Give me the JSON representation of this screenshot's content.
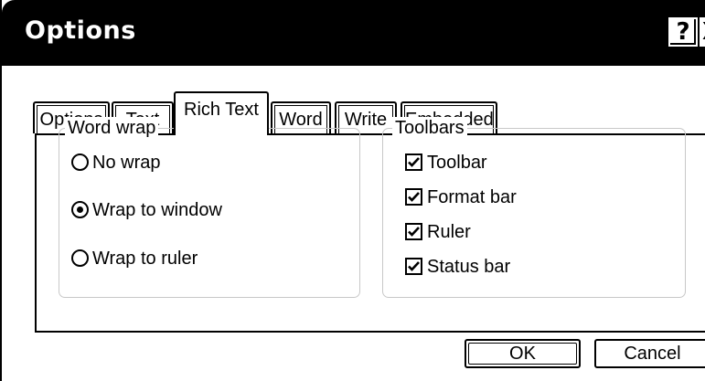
{
  "window": {
    "title": "Options",
    "help_glyph": "?",
    "close_glyph": "X"
  },
  "tabs": [
    {
      "label": "Options",
      "active": false
    },
    {
      "label": "Text",
      "active": false
    },
    {
      "label": "Rich Text",
      "active": true
    },
    {
      "label": "Word",
      "active": false
    },
    {
      "label": "Write",
      "active": false
    },
    {
      "label": "Embedded",
      "active": false
    }
  ],
  "word_wrap": {
    "label": "Word wrap",
    "options": [
      {
        "label": "No wrap",
        "selected": false
      },
      {
        "label": "Wrap to window",
        "selected": true
      },
      {
        "label": "Wrap to ruler",
        "selected": false
      }
    ]
  },
  "toolbars": {
    "label": "Toolbars",
    "items": [
      {
        "label": "Toolbar",
        "checked": true
      },
      {
        "label": "Format bar",
        "checked": true
      },
      {
        "label": "Ruler",
        "checked": true
      },
      {
        "label": "Status bar",
        "checked": true
      }
    ]
  },
  "buttons": {
    "ok_label": "OK",
    "cancel_label": "Cancel"
  }
}
